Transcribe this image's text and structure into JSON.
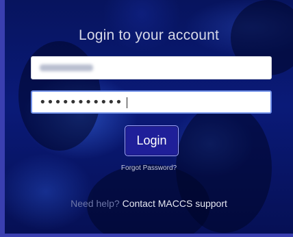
{
  "login": {
    "title": "Login to your account",
    "username_value": "",
    "password_mask": "•••••••••••",
    "login_label": "Login",
    "forgot_label": "Forgot Password?",
    "help_prefix": "Need help?",
    "help_link": "Contact MACCS support"
  },
  "colors": {
    "background_blue": "#0a1a78",
    "button_blue": "#1f1f99",
    "focus_border": "#6f8fe8"
  }
}
